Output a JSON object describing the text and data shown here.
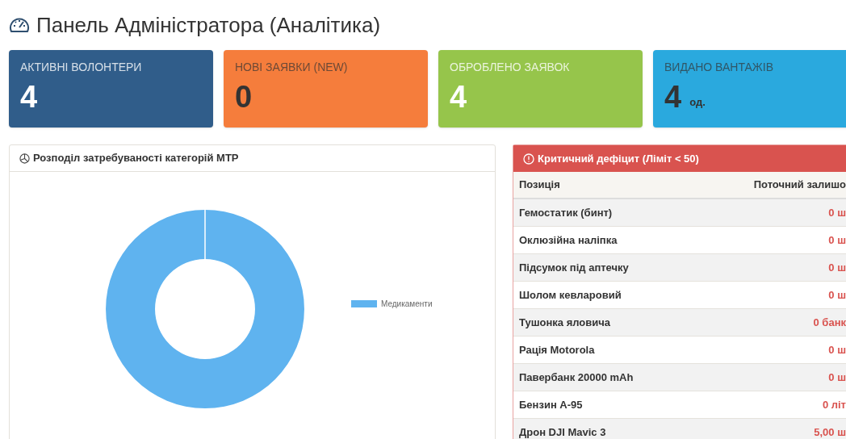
{
  "page_title": "Панель Адміністратора (Аналітика)",
  "stat_cards": [
    {
      "label": "АКТИВНІ ВОЛОНТЕРИ",
      "value": "4",
      "color": "#305d8a"
    },
    {
      "label": "НОВІ ЗАЯВКИ (NEW)",
      "value": "0",
      "color": "#f57d3c"
    },
    {
      "label": "ОБРОБЛЕНО ЗАЯВОК",
      "value": "4",
      "color": "#96c54b"
    },
    {
      "label": "ВИДАНО ВАНТАЖІВ",
      "value": "4",
      "unit": "од.",
      "color": "#2aa9de"
    }
  ],
  "category_panel": {
    "title": "Розподіл затребуваності категорій МТР",
    "legend": [
      {
        "label": "Медикаменти",
        "color": "#5fb3ef"
      }
    ]
  },
  "deficit_panel": {
    "title": "Критичний дефіцит (Ліміт < 50)",
    "columns": [
      "Позиція",
      "Поточний залишо"
    ],
    "rows": [
      [
        "Гемостатик (бинт)",
        "0 ш"
      ],
      [
        "Оклюзійна наліпка",
        "0 ш"
      ],
      [
        "Підсумок під аптечку",
        "0 ш"
      ],
      [
        "Шолом кевларовий",
        "0 ш"
      ],
      [
        "Тушонка яловича",
        "0 банк"
      ],
      [
        "Рація Motorola",
        "0 ш"
      ],
      [
        "Павербанк 20000 mAh",
        "0 ш"
      ],
      [
        "Бензин А-95",
        "0 літ"
      ],
      [
        "Дрон DJI Mavic 3",
        "5,00 ш"
      ]
    ]
  }
}
